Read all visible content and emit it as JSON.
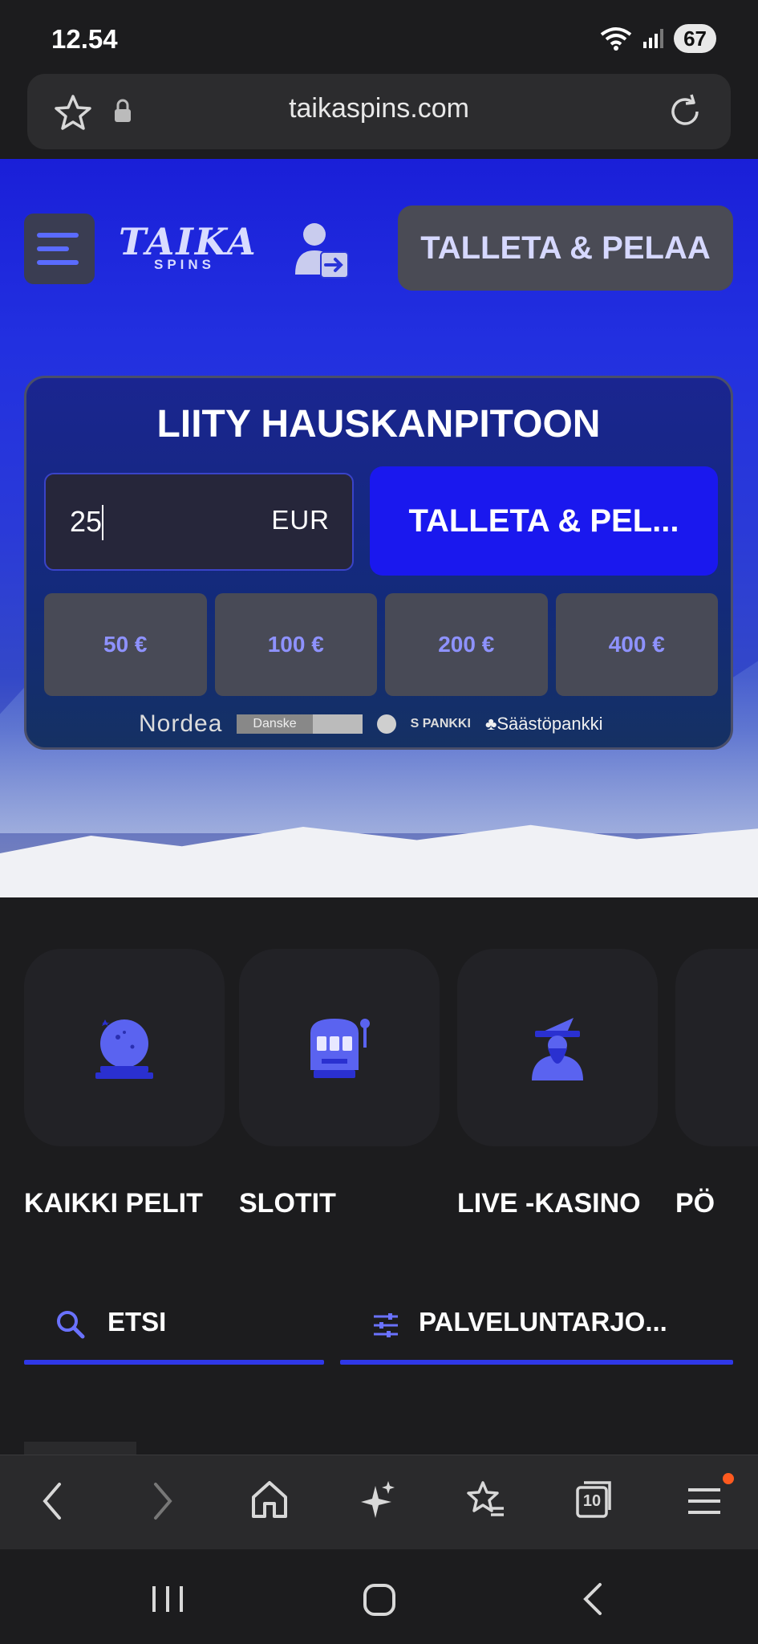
{
  "status": {
    "time": "12.54",
    "battery": "67"
  },
  "browser": {
    "url": "taikaspins.com",
    "tab_count": "10"
  },
  "header": {
    "logo_main": "TAIKA",
    "logo_sub": "SPINS",
    "cta_label": "TALLETA & PELAA"
  },
  "deposit_card": {
    "title": "LIITY HAUSKANPITOON",
    "amount": "25",
    "currency": "EUR",
    "submit_label": "TALLETA & PEL...",
    "quick_amounts": [
      "50 €",
      "100 €",
      "200 €",
      "400 €"
    ],
    "banks": {
      "nordea": "Nordea",
      "danske": "Danske",
      "spankki": "PANKKI",
      "saastopankki": "Säästöpankki"
    }
  },
  "categories": [
    {
      "label": "KAIKKI PELIT",
      "icon": "crystal-ball-icon"
    },
    {
      "label": "SLOTIT",
      "icon": "slot-machine-icon"
    },
    {
      "label": "LIVE -KASINO",
      "icon": "wizard-icon"
    },
    {
      "label": "PÖ",
      "icon": ""
    }
  ],
  "filters": {
    "search_label": "ETSI",
    "provider_label": "PALVELUNTARJO..."
  },
  "colors": {
    "accent": "#2f38e8",
    "brand_blue": "#1a18ee",
    "chip_text": "#8e92ff"
  }
}
